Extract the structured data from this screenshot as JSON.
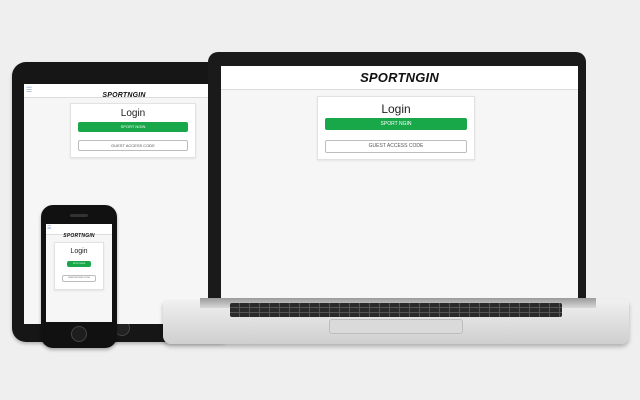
{
  "logo": "SPORTNGIN",
  "login": {
    "title": "Login",
    "primary_button": "SPORT NGIN",
    "secondary_button": "GUEST ACCESS CODE"
  },
  "icons": {
    "menu": "hamburger-menu-icon"
  },
  "colors": {
    "primary": "#18a84a",
    "background": "#efefef",
    "device_frame": "#161616"
  }
}
